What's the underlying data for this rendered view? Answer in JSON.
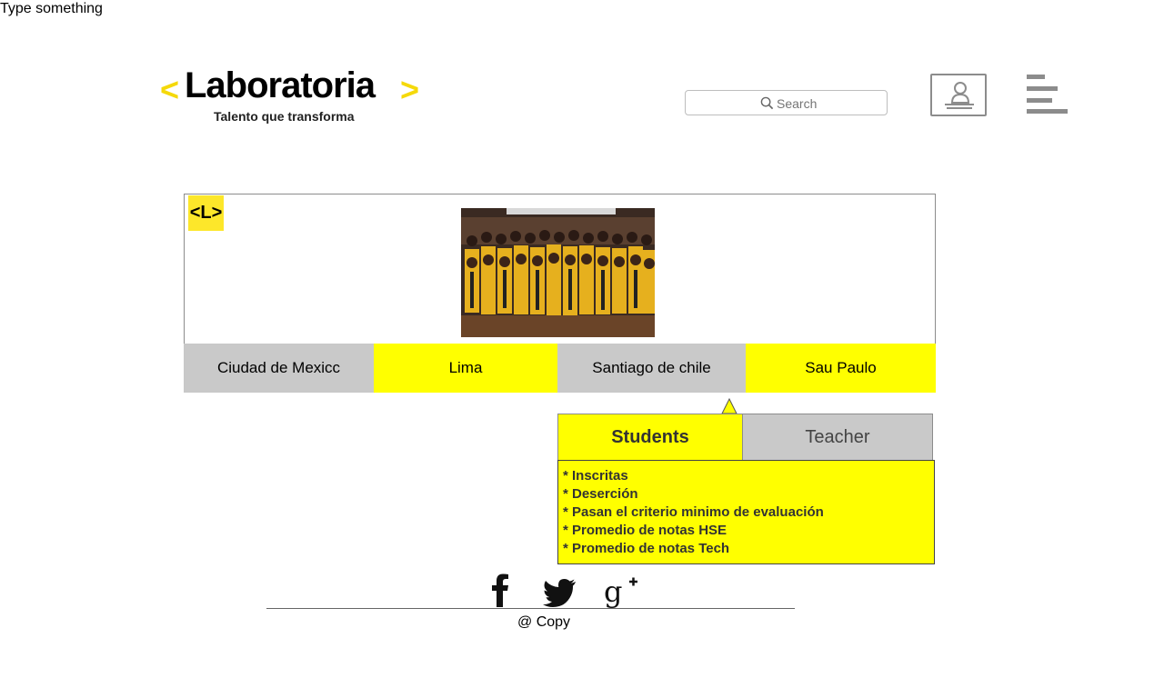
{
  "note": "Type something",
  "logo": {
    "word": "Laboratoria",
    "tagline": "Talento que transforma",
    "left_chevron": "<",
    "right_chevron": ">"
  },
  "search": {
    "placeholder": "Search",
    "icon": "search-icon"
  },
  "icons": {
    "user": "user-profile-icon",
    "menu": "hamburger-menu-icon"
  },
  "hero": {
    "badge": "<L>",
    "photo_alt": "group-photo"
  },
  "cities": [
    {
      "label": "Ciudad de Mexicc"
    },
    {
      "label": "Lima"
    },
    {
      "label": "Santiago de chile"
    },
    {
      "label": "Sau Paulo"
    }
  ],
  "roles": [
    {
      "label": "Students"
    },
    {
      "label": "Teacher"
    }
  ],
  "stats": [
    "* Inscritas",
    "* Deserción",
    "* Pasan el criterio minimo de evaluación",
    "* Promedio de notas HSE",
    "* Promedio de notas Tech"
  ],
  "footer": {
    "social": [
      "facebook-icon",
      "twitter-icon",
      "google-plus-icon"
    ],
    "copy": "@ Copy"
  },
  "colors": {
    "accent_yellow": "#ffff00",
    "logo_yellow": "#f5d90a",
    "tab_grey": "#c9c9c9"
  }
}
